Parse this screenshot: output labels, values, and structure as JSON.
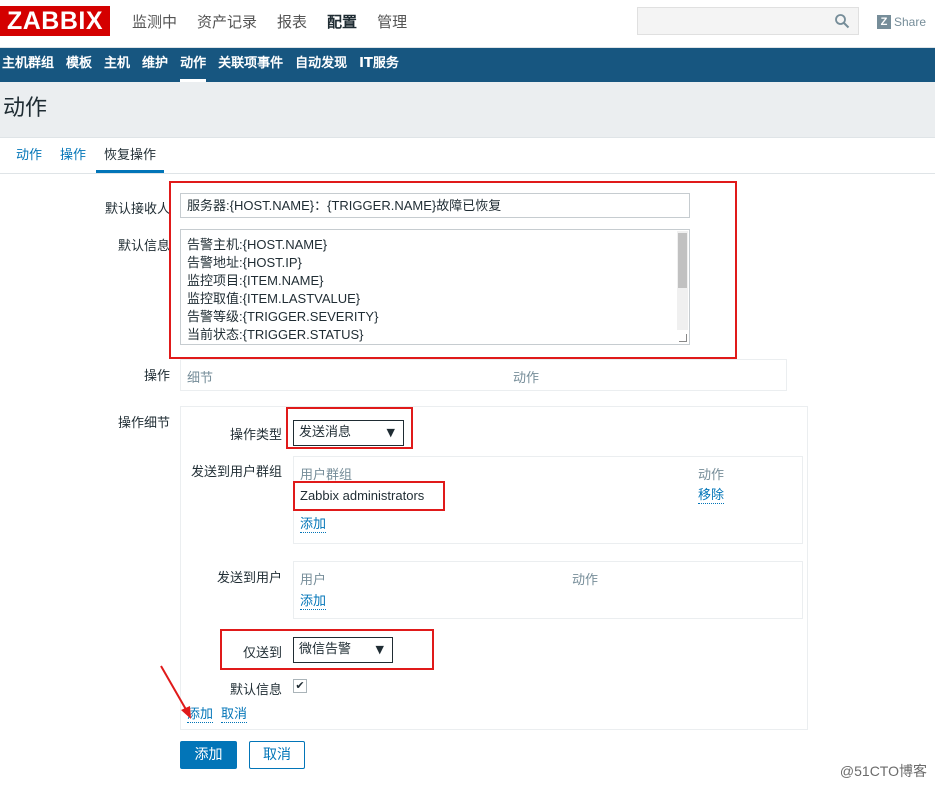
{
  "header": {
    "logo": "ZABBIX",
    "menu": [
      "监测中",
      "资产记录",
      "报表",
      "配置",
      "管理"
    ],
    "search_placeholder": "",
    "share_label": "Share"
  },
  "subnav": [
    "主机群组",
    "模板",
    "主机",
    "维护",
    "动作",
    "关联项事件",
    "自动发现",
    "IT服务"
  ],
  "page_title": "动作",
  "tabs": [
    "动作",
    "操作",
    "恢复操作"
  ],
  "form": {
    "default_recipient_label": "默认接收人",
    "default_recipient_value": "服务器:{HOST.NAME}：{TRIGGER.NAME}故障已恢复",
    "default_message_label": "默认信息",
    "default_message_lines": [
      "告警主机:{HOST.NAME}",
      "告警地址:{HOST.IP}",
      "监控项目:{ITEM.NAME}",
      "监控取值:{ITEM.LASTVALUE}",
      "告警等级:{TRIGGER.SEVERITY}",
      "当前状态:{TRIGGER.STATUS}"
    ],
    "operations_label": "操作",
    "operations_col_details": "细节",
    "operations_col_action": "动作",
    "op_details_label": "操作细节",
    "op_type_label": "操作类型",
    "op_type_value": "发送消息",
    "send_to_groups_label": "发送到用户群组",
    "groups_col_group": "用户群组",
    "groups_col_action": "动作",
    "group_row_name": "Zabbix administrators",
    "group_row_remove": "移除",
    "groups_add": "添加",
    "send_to_users_label": "发送到用户",
    "users_col_user": "用户",
    "users_col_action": "动作",
    "users_add": "添加",
    "send_only_label": "仅送到",
    "send_only_value": "微信告警",
    "default_message_check_label": "默认信息",
    "default_message_checked": "✔",
    "inner_add": "添加",
    "inner_cancel": "取消",
    "add_button": "添加",
    "cancel_button": "取消"
  },
  "colors": {
    "brand_red": "#d40000",
    "nav_blue": "#175680",
    "link_blue": "#0275b8",
    "highlight_red": "#e01a1a"
  },
  "watermark": "@51CTO博客"
}
